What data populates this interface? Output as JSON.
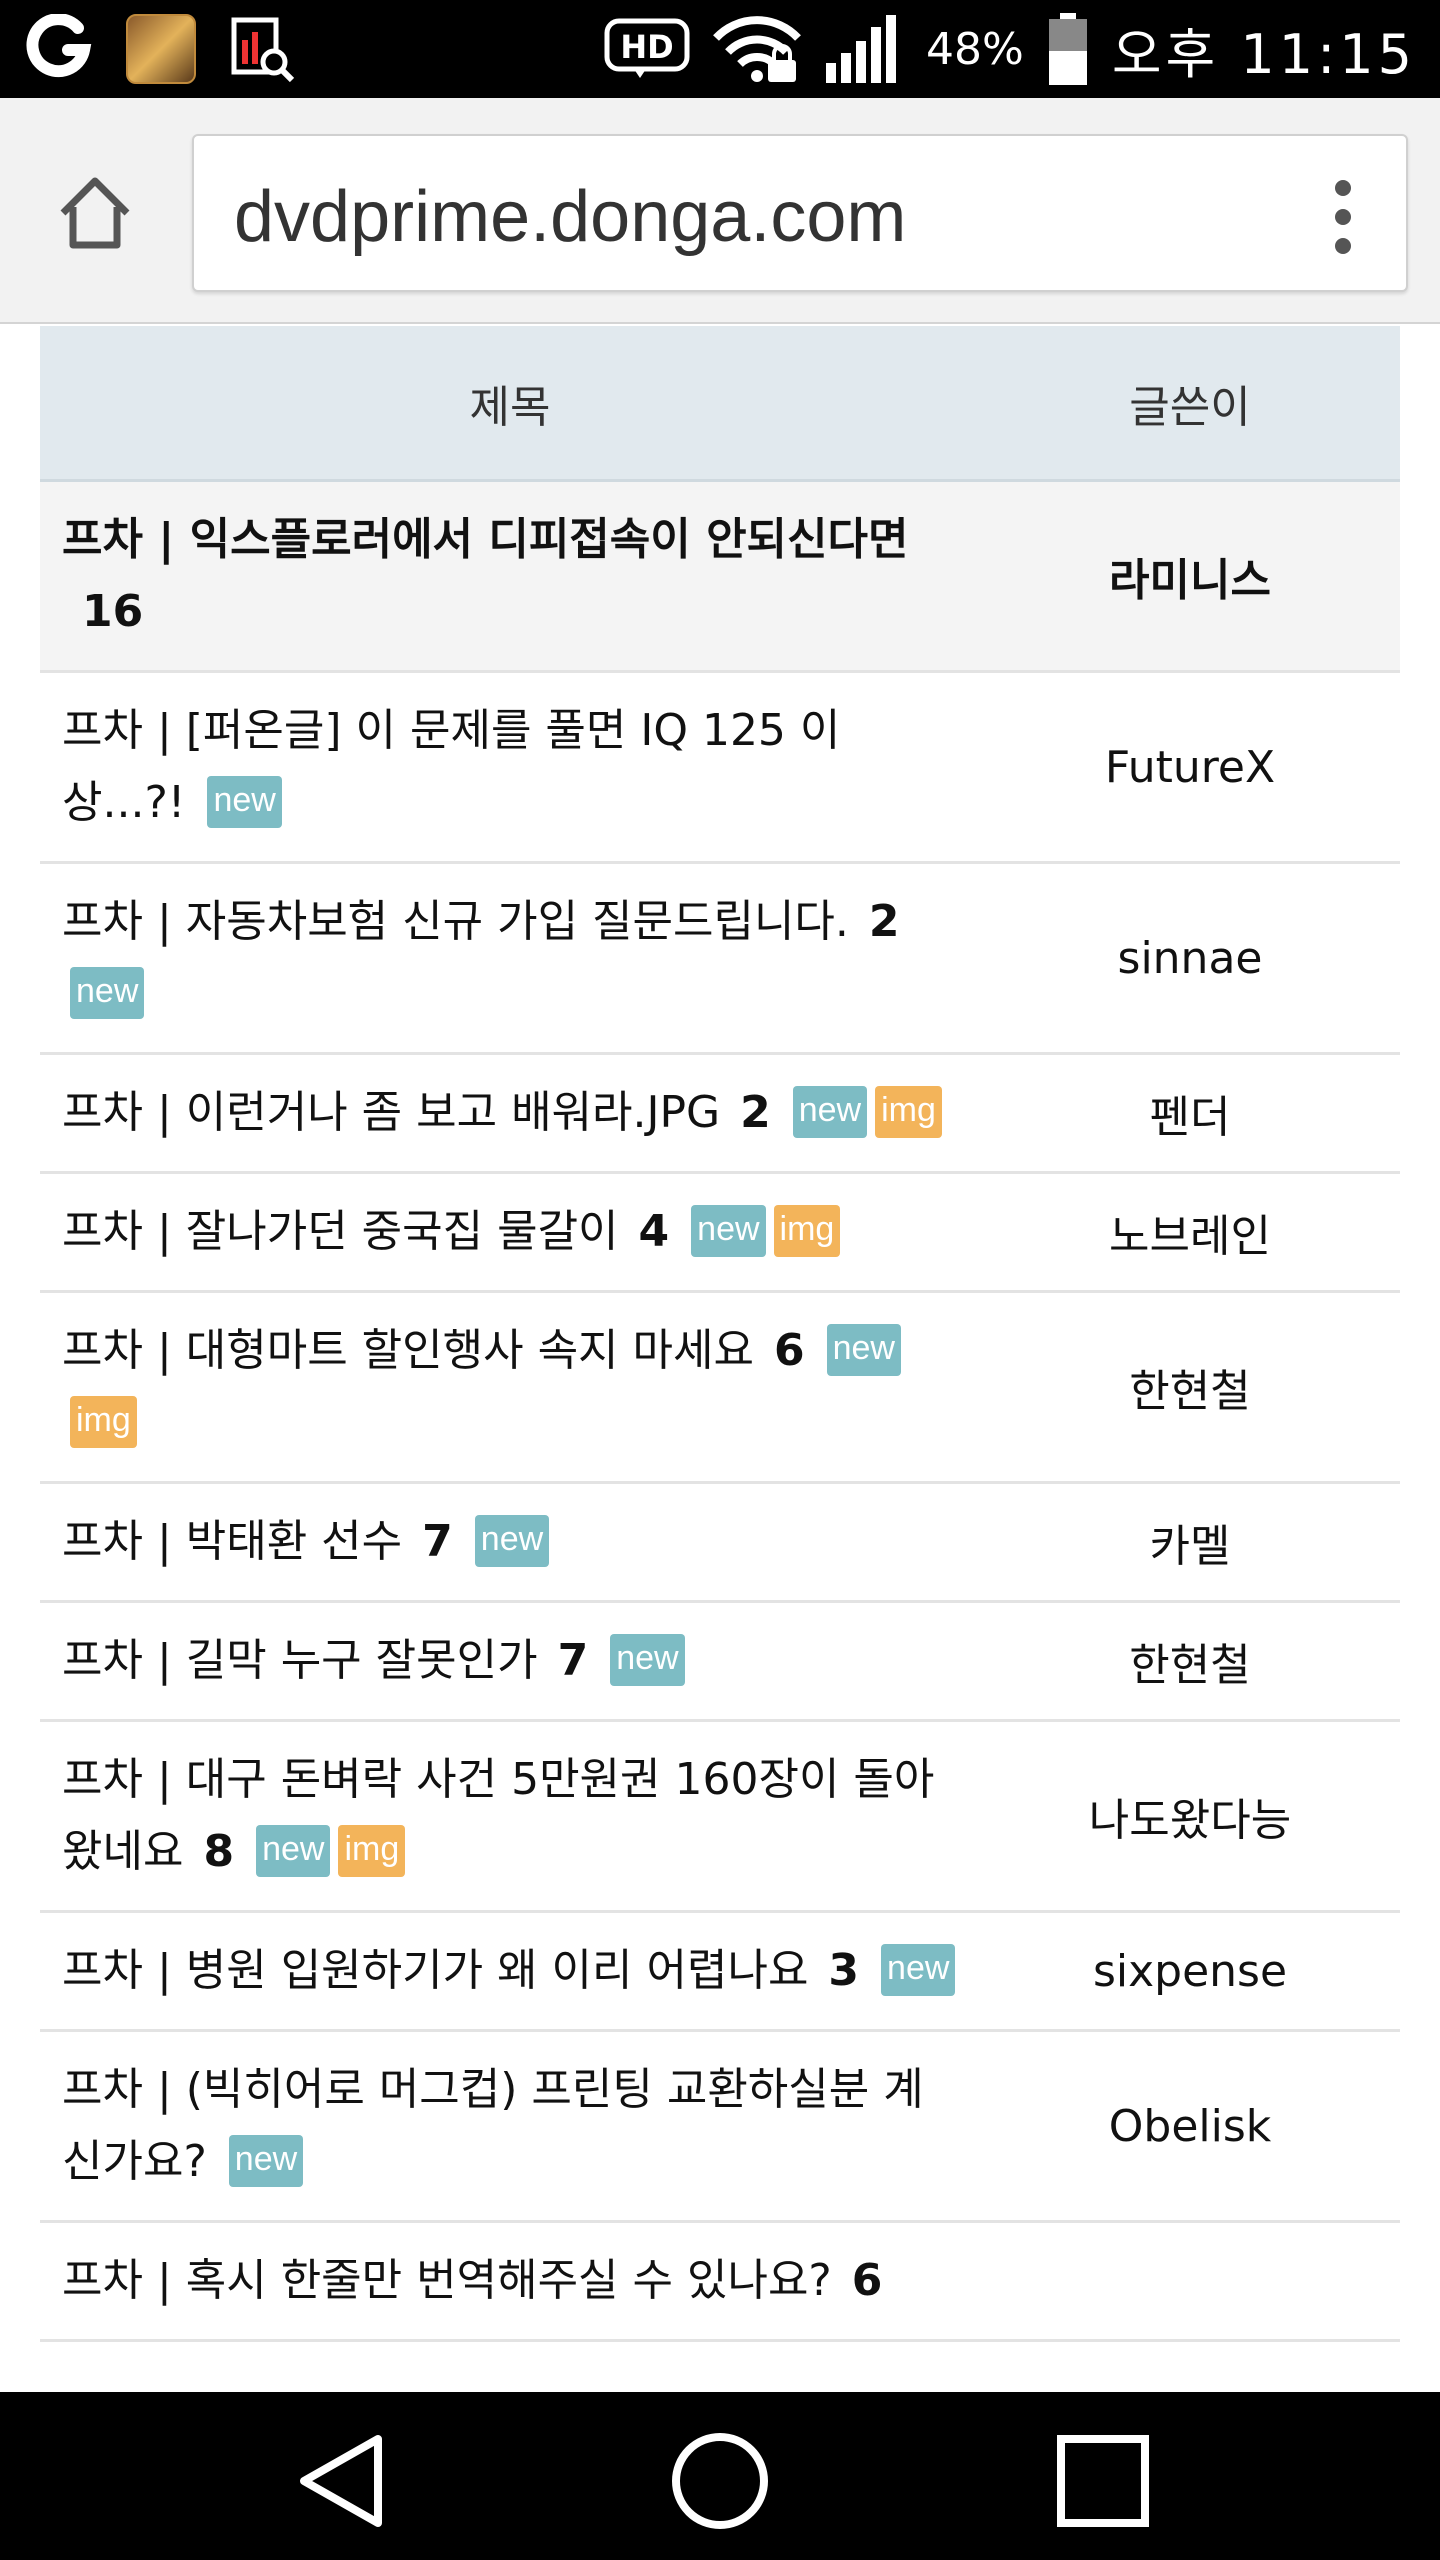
{
  "status_bar": {
    "battery": "48%",
    "time": "오후 11:15",
    "left_icons": [
      "app-o-icon",
      "game-app-icon",
      "chart-search-icon"
    ],
    "right_icons": [
      "hd-icon",
      "wifi-lock-icon",
      "signal-icon",
      "battery-icon"
    ],
    "hd_label": "HD"
  },
  "browser": {
    "url": "dvdprime.donga.com"
  },
  "board": {
    "header": {
      "title": "제목",
      "author": "글쓴이"
    },
    "rows": [
      {
        "title": "프차 | 익스플로러에서 디피접속이 안되신다면",
        "comments": "16",
        "badges": [],
        "author": "라미니스",
        "notice": true
      },
      {
        "title": "프차 | [퍼온글] 이 문제를 풀면 IQ 125 이상...?!",
        "comments": "",
        "badges": [
          "new"
        ],
        "author": "FutureX"
      },
      {
        "title": "프차 | 자동차보험 신규 가입 질문드립니다.",
        "comments": "2",
        "badges": [
          "new"
        ],
        "author": "sinnae"
      },
      {
        "title": "프차 | 이런거나 좀 보고 배워라.JPG",
        "comments": "2",
        "badges": [
          "new",
          "img"
        ],
        "author": "펜더"
      },
      {
        "title": "프차 | 잘나가던 중국집 물갈이",
        "comments": "4",
        "badges": [
          "new",
          "img"
        ],
        "author": "노브레인"
      },
      {
        "title": "프차 | 대형마트 할인행사 속지 마세요",
        "comments": "6",
        "badges": [
          "new",
          "img"
        ],
        "author": "한현철"
      },
      {
        "title": "프차 | 박태환 선수",
        "comments": "7",
        "badges": [
          "new"
        ],
        "author": "카멜"
      },
      {
        "title": "프차 | 길막 누구 잘못인가",
        "comments": "7",
        "badges": [
          "new"
        ],
        "author": "한현철"
      },
      {
        "title": "프차 | 대구 돈벼락 사건 5만원권 160장이 돌아왔네요",
        "comments": "8",
        "badges": [
          "new",
          "img"
        ],
        "author": "나도왔다능"
      },
      {
        "title": "프차 | 병원 입원하기가 왜 이리 어렵나요",
        "comments": "3",
        "badges": [
          "new"
        ],
        "author": "sixpense"
      },
      {
        "title": "프차 | (빅히어로 머그컵) 프린팅 교환하실분 계신가요?",
        "comments": "",
        "badges": [
          "new"
        ],
        "author": "Obelisk"
      },
      {
        "title": "프차 | 혹시 한줄만 번역해주실 수 있나요?",
        "comments": "6",
        "badges": [],
        "author": ""
      }
    ]
  },
  "nav_bar": {
    "buttons": [
      "back-icon",
      "home-circle-icon",
      "recents-icon"
    ]
  },
  "colors": {
    "new_badge": "#7dbcc4",
    "img_badge": "#f3b45a",
    "header_bg": "#e1e9ee"
  }
}
